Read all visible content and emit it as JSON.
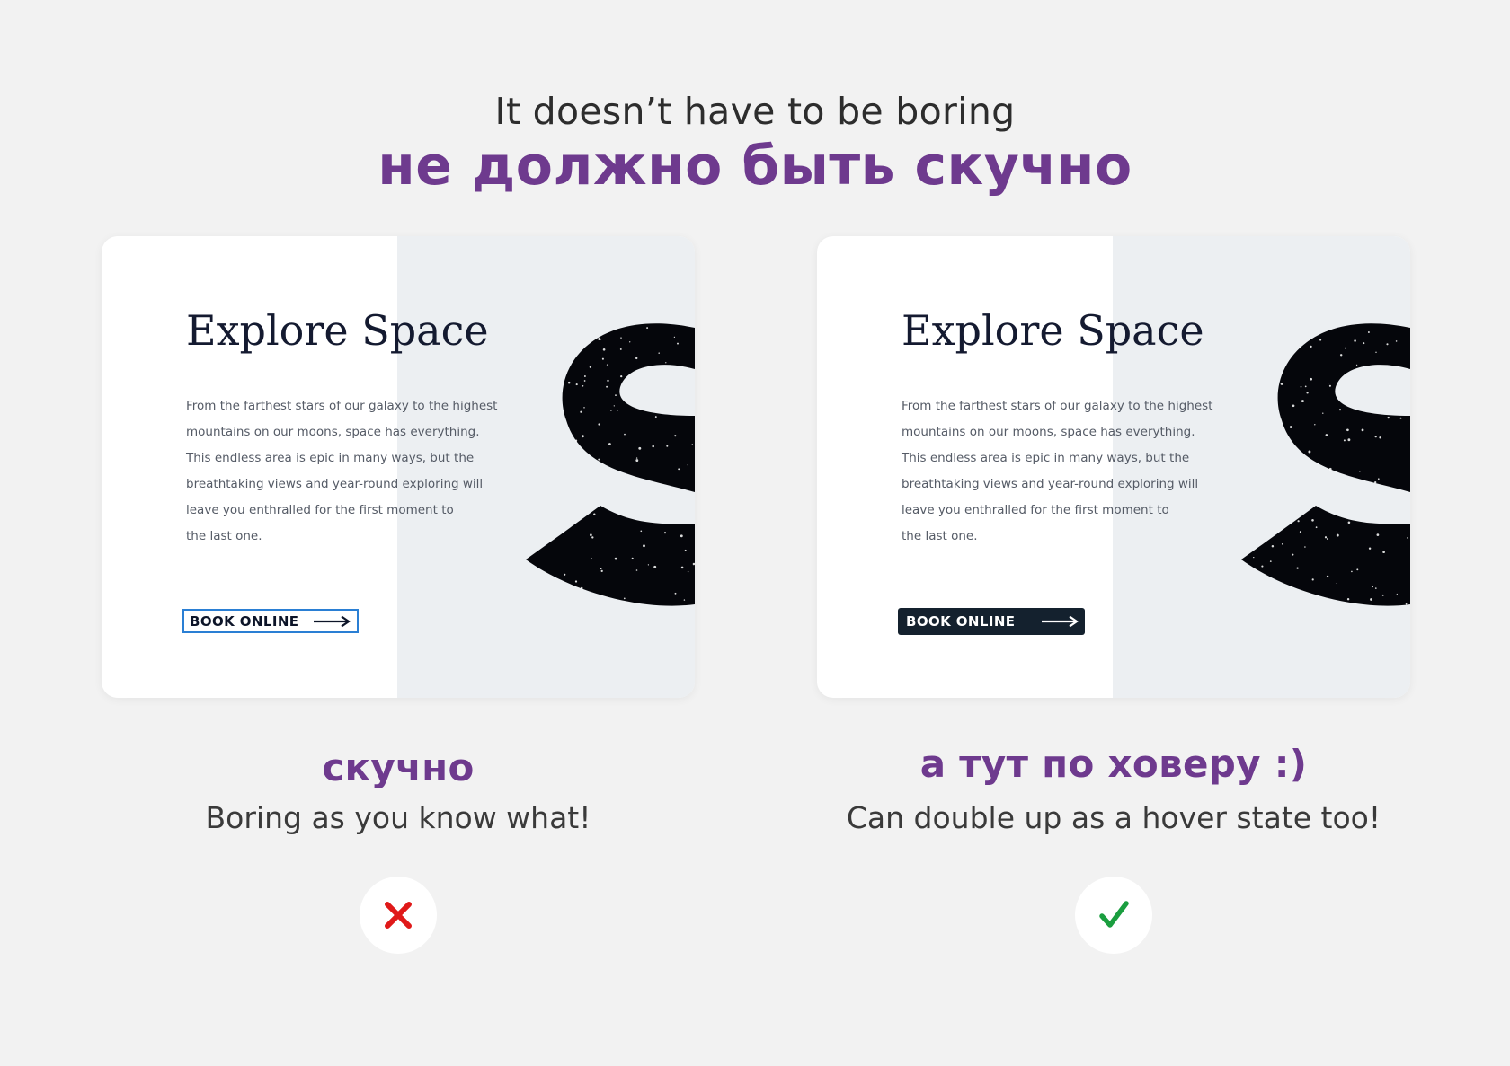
{
  "heading": {
    "english": "It doesn’t have to be boring",
    "russian": "не должно быть скучно"
  },
  "colors": {
    "accent_purple": "#6e3a8e",
    "button_outline_blue": "#2a7fd4",
    "button_fill_dark": "#14212e",
    "cross_red": "#e01919",
    "check_green": "#1a9e3f"
  },
  "examples": [
    {
      "card": {
        "title": "Explore Space",
        "body_lines": [
          "From the farthest stars of our galaxy to the highest",
          "mountains on our moons, space has everything.",
          "This endless area is epic in many ways, but the",
          "breathtaking views and year-round exploring will",
          "leave you enthralled for the first moment to",
          "the last one."
        ],
        "cta_label": "BOOK ONLINE",
        "cta_style": "outlined"
      },
      "caption_ru": "скучно",
      "caption_en": "Boring as you know what!",
      "verdict_icon": "cross-icon"
    },
    {
      "card": {
        "title": "Explore Space",
        "body_lines": [
          "From the farthest stars of our galaxy to the highest",
          "mountains on our moons, space has everything.",
          "This endless area is epic in many ways, but the",
          "breathtaking views and year-round exploring will",
          "leave you enthralled for the first moment to",
          "the last one."
        ],
        "cta_label": "BOOK ONLINE",
        "cta_style": "filled"
      },
      "caption_ru": "а тут по ховеру :)",
      "caption_en": "Can double up as a hover state too!",
      "verdict_icon": "check-icon"
    }
  ]
}
